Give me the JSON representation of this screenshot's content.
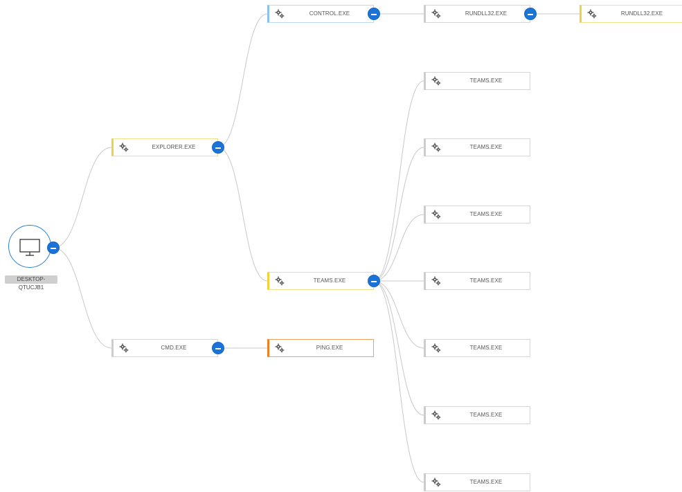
{
  "root": {
    "label": "DESKTOP-QTUCJB1",
    "icon": "monitor-icon"
  },
  "toggle_icon": "minus-circle-icon",
  "node_icon": "process-gear-icon",
  "colors": {
    "accent": "#1b73d8",
    "yellow": "#f0d23c",
    "blue": "#8ec1ea",
    "orange": "#ee7f26",
    "gray": "#cccccc",
    "edge": "#c8c8c8"
  },
  "processes": [
    {
      "id": "explorer",
      "label": "EXPLORER.EXE",
      "color": "yellow",
      "expanded": true
    },
    {
      "id": "cmd",
      "label": "CMD.EXE",
      "color": "gray",
      "expanded": true
    },
    {
      "id": "control",
      "label": "CONTROL.EXE",
      "color": "blue",
      "expanded": true
    },
    {
      "id": "teams",
      "label": "TEAMS.EXE",
      "color": "yellow",
      "expanded": true
    },
    {
      "id": "ping",
      "label": "PING.EXE",
      "color": "orange",
      "expanded": false
    },
    {
      "id": "rundll32a",
      "label": "RUNDLL32.EXE",
      "color": "gray",
      "expanded": true
    },
    {
      "id": "rundll32b",
      "label": "RUNDLL32.EXE",
      "color": "yellow",
      "expanded": false
    },
    {
      "id": "teams1",
      "label": "TEAMS.EXE",
      "color": "gray",
      "expanded": false
    },
    {
      "id": "teams2",
      "label": "TEAMS.EXE",
      "color": "gray",
      "expanded": false
    },
    {
      "id": "teams3",
      "label": "TEAMS.EXE",
      "color": "gray",
      "expanded": false
    },
    {
      "id": "teams4",
      "label": "TEAMS.EXE",
      "color": "gray",
      "expanded": false
    },
    {
      "id": "teams5",
      "label": "TEAMS.EXE",
      "color": "gray",
      "expanded": false
    },
    {
      "id": "teams6",
      "label": "TEAMS.EXE",
      "color": "gray",
      "expanded": false
    },
    {
      "id": "teams7",
      "label": "TEAMS.EXE",
      "color": "gray",
      "expanded": false
    }
  ],
  "edges": [
    [
      "root",
      "explorer"
    ],
    [
      "root",
      "cmd"
    ],
    [
      "explorer",
      "control"
    ],
    [
      "explorer",
      "teams"
    ],
    [
      "cmd",
      "ping"
    ],
    [
      "control",
      "rundll32a"
    ],
    [
      "rundll32a",
      "rundll32b"
    ],
    [
      "teams",
      "teams1"
    ],
    [
      "teams",
      "teams2"
    ],
    [
      "teams",
      "teams3"
    ],
    [
      "teams",
      "teams4"
    ],
    [
      "teams",
      "teams5"
    ],
    [
      "teams",
      "teams6"
    ],
    [
      "teams",
      "teams7"
    ]
  ]
}
